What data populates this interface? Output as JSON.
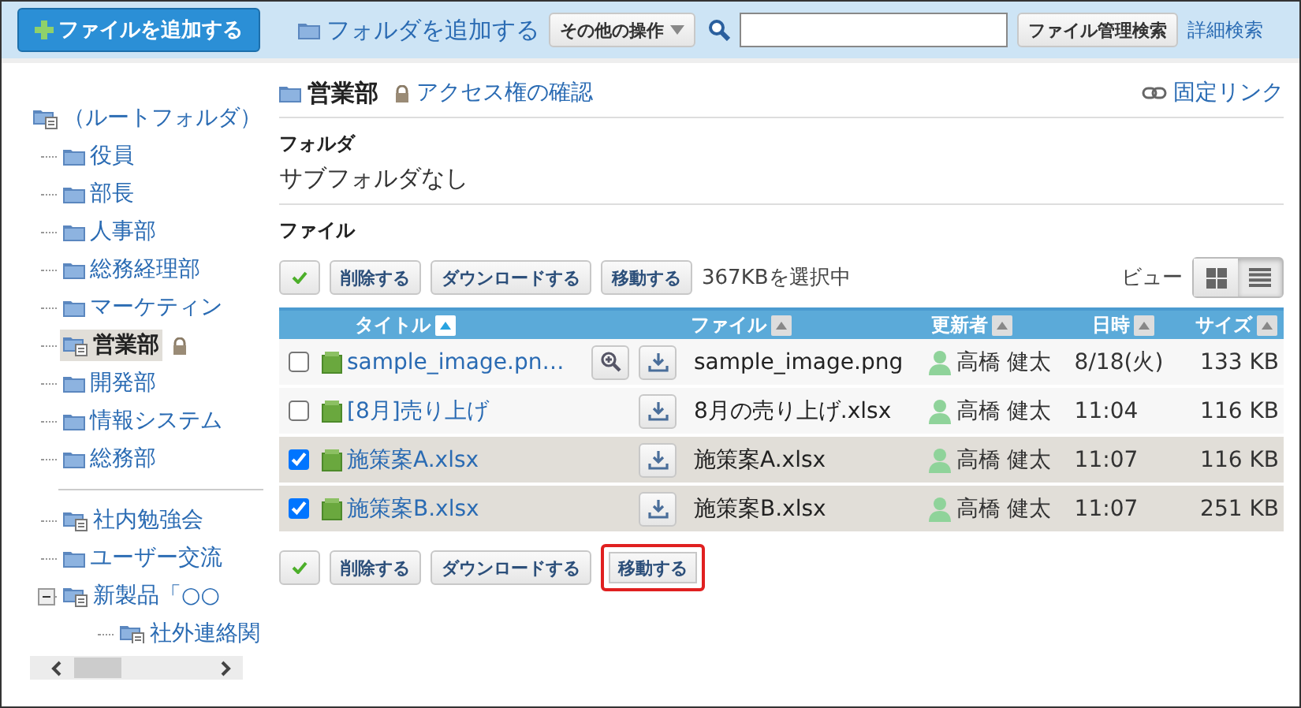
{
  "header": {
    "add_file": "ファイルを追加する",
    "add_folder": "フォルダを追加する",
    "other_actions": "その他の操作",
    "search_button": "ファイル管理検索",
    "advanced_search": "詳細検索"
  },
  "sidebar": {
    "tree": [
      {
        "label": "（ルートフォルダ）",
        "kind": "doc-folder",
        "selected": false,
        "children": [
          {
            "label": "役員",
            "kind": "folder",
            "selected": false
          },
          {
            "label": "部長",
            "kind": "folder",
            "selected": false
          },
          {
            "label": "人事部",
            "kind": "folder",
            "selected": false
          },
          {
            "label": "総務経理部",
            "kind": "folder",
            "selected": false
          },
          {
            "label": "マーケティン",
            "kind": "folder",
            "selected": false
          },
          {
            "label": "営業部",
            "kind": "doc-folder",
            "selected": true,
            "locked": true
          },
          {
            "label": "開発部",
            "kind": "folder",
            "selected": false
          },
          {
            "label": "情報システム",
            "kind": "folder",
            "selected": false
          },
          {
            "label": "総務部",
            "kind": "folder",
            "selected": false
          },
          {
            "kind": "separator"
          },
          {
            "label": "社内勉強会",
            "kind": "doc-folder",
            "selected": false
          },
          {
            "label": "ユーザー交流",
            "kind": "folder",
            "selected": false
          },
          {
            "label": "新製品「○○",
            "kind": "doc-folder",
            "selected": false,
            "expanded": true,
            "children": [
              {
                "label": "社外連絡関",
                "kind": "doc-folder",
                "selected": false
              }
            ]
          }
        ]
      }
    ]
  },
  "folder": {
    "title": "営業部",
    "access_link": "アクセス権の確認",
    "permalink": "固定リンク"
  },
  "subfolders": {
    "label": "フォルダ",
    "text": "サブフォルダなし"
  },
  "files": {
    "label": "ファイル",
    "actions": [
      {
        "label": "削除する",
        "highlighted": false
      },
      {
        "label": "ダウンロードする",
        "highlighted": false
      },
      {
        "label": "移動する",
        "highlighted": false
      }
    ],
    "selection": "367KBを選択中",
    "view_label": "ビュー",
    "views": [
      {
        "kind": "grid",
        "selected": false
      },
      {
        "kind": "list",
        "selected": true
      }
    ],
    "columns": [
      {
        "label": "タイトル",
        "sorted": true
      },
      {
        "label": "ファイル",
        "sorted": false
      },
      {
        "label": "更新者",
        "sorted": false
      },
      {
        "label": "日時",
        "sorted": false
      },
      {
        "label": "サイズ",
        "sorted": false
      }
    ],
    "rows": [
      {
        "checked": false,
        "title": "sample_image.pn…",
        "preview": true,
        "file": "sample_image.png",
        "user": "高橋 健太",
        "date": "8/18(火)",
        "size": "133 KB"
      },
      {
        "checked": false,
        "title": "[8月]売り上げ",
        "preview": false,
        "file": "8月の売り上げ.xlsx",
        "user": "高橋 健太",
        "date": "11:04",
        "size": "116 KB"
      },
      {
        "checked": true,
        "title": "施策案A.xlsx",
        "preview": false,
        "file": "施策案A.xlsx",
        "user": "高橋 健太",
        "date": "11:07",
        "size": "116 KB"
      },
      {
        "checked": true,
        "title": "施策案B.xlsx",
        "preview": false,
        "file": "施策案B.xlsx",
        "user": "高橋 健太",
        "date": "11:07",
        "size": "251 KB"
      }
    ],
    "bottom_actions": [
      {
        "label": "削除する",
        "highlighted": false
      },
      {
        "label": "ダウンロードする",
        "highlighted": false
      },
      {
        "label": "移動する",
        "highlighted": true
      }
    ]
  }
}
